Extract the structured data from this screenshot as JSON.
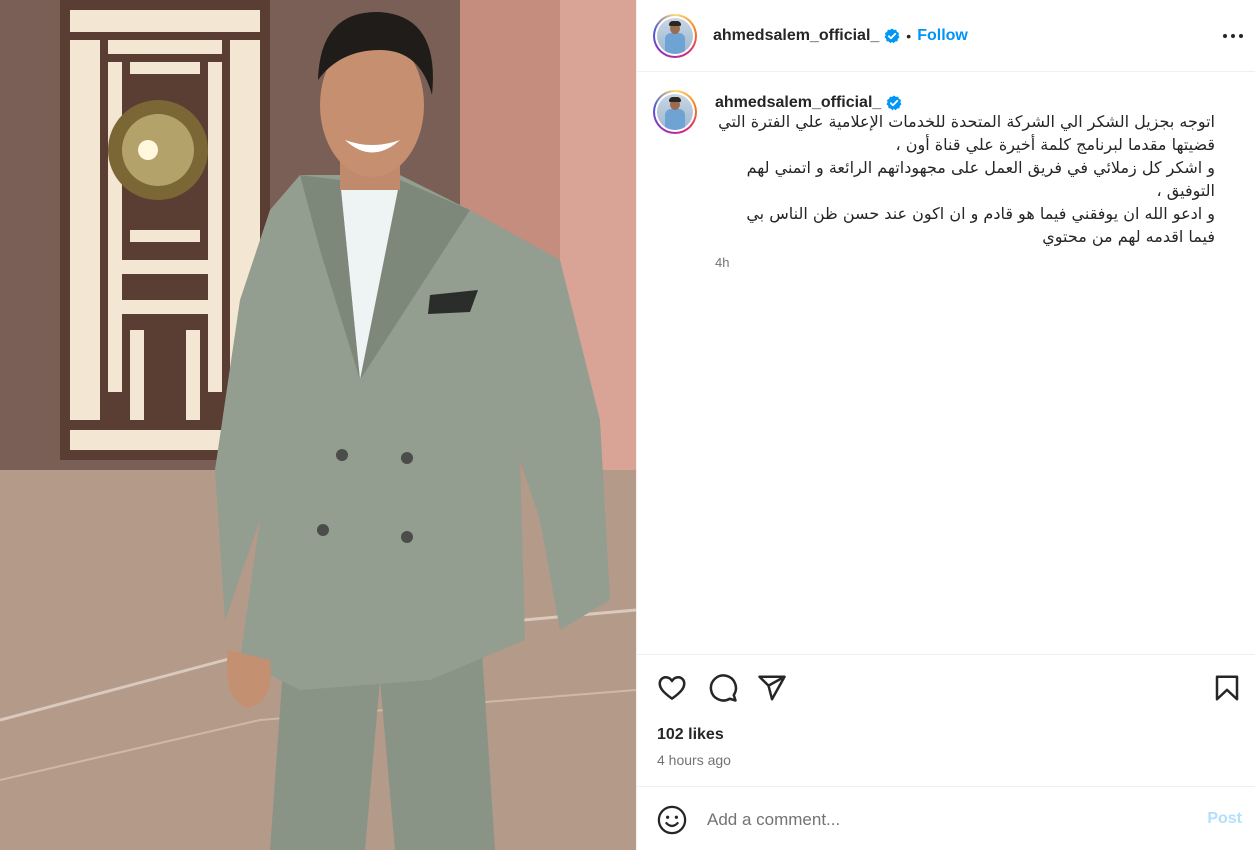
{
  "post": {
    "username": "ahmedsalem_official_",
    "follow_label": "Follow",
    "separator": "•",
    "caption": "اتوجه بجزيل الشكر الي الشركة المتحدة للخدمات الإعلامية علي الفترة التي قضيتها مقدما لبرنامج كلمة أخيرة علي قناة أون ،\nو اشكر كل زملائي في فريق العمل على مجهوداتهم الرائعة و اتمني لهم التوفيق ،\nو ادعو الله ان يوفقني فيما هو قادم و ان اكون عند حسن ظن الناس بي فيما اقدمه لهم من محتوي",
    "caption_time": "4h",
    "likes": "102 likes",
    "time_ago": "4 hours ago"
  },
  "comment": {
    "placeholder": "Add a comment...",
    "post_label": "Post"
  },
  "icons": {
    "verified": "verified-badge-icon",
    "more": "more-options-icon",
    "like": "heart-icon",
    "comment": "comment-icon",
    "share": "share-icon",
    "save": "bookmark-icon",
    "emoji": "emoji-icon"
  },
  "colors": {
    "accent": "#0095f6",
    "muted": "#737373",
    "post_disabled": "#b2dffc",
    "suit": "#8f9a8c"
  }
}
